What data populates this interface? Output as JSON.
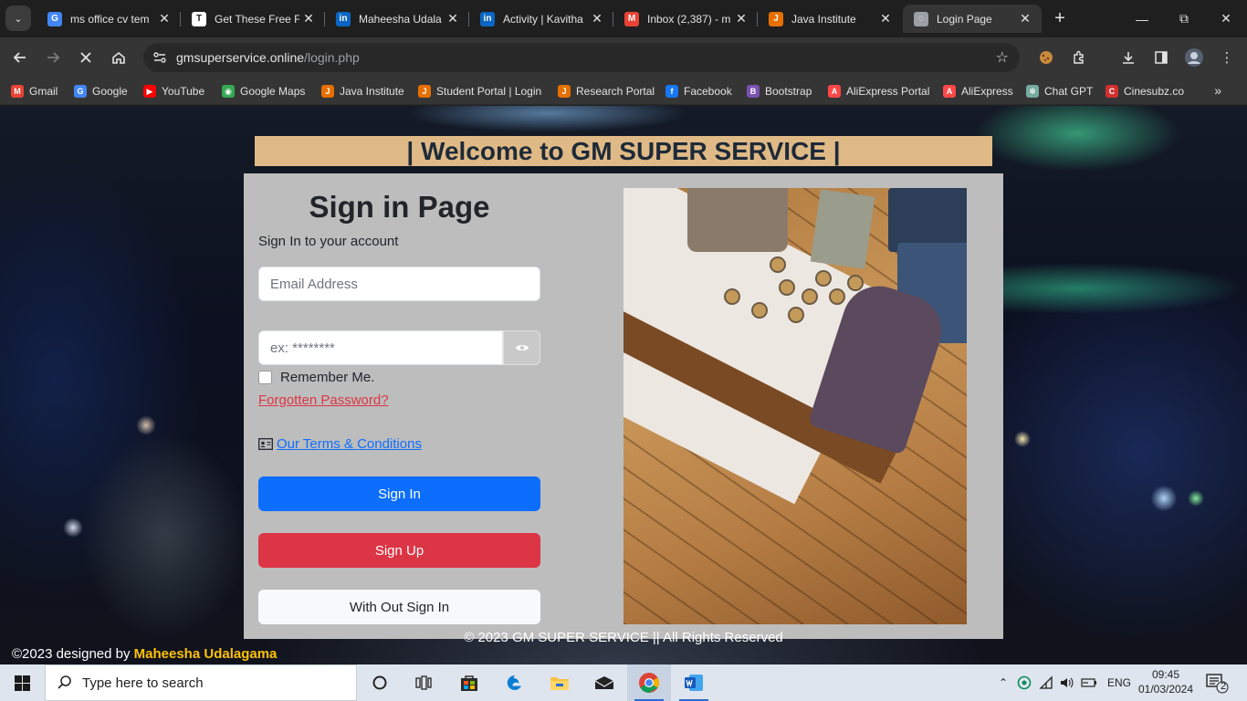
{
  "browser": {
    "tabs": [
      {
        "title": "ms office cv tem",
        "favicon": "google-icon",
        "color": "#4285f4",
        "glyph": "G"
      },
      {
        "title": "Get These Free F",
        "favicon": "doc-icon",
        "color": "#ffffff",
        "glyph": "T"
      },
      {
        "title": "Maheesha Udala",
        "favicon": "linkedin-icon",
        "color": "#0a66c2",
        "glyph": "in"
      },
      {
        "title": "Activity | Kavitha",
        "favicon": "linkedin-icon",
        "color": "#0a66c2",
        "glyph": "in"
      },
      {
        "title": "Inbox (2,387) - m",
        "favicon": "gmail-icon",
        "color": "#ea4335",
        "glyph": "M"
      },
      {
        "title": "Java Institute",
        "favicon": "java-icon",
        "color": "#e76f00",
        "glyph": "J"
      },
      {
        "title": "Login Page",
        "favicon": "loading-icon",
        "color": "#9aa0a6",
        "glyph": "◌",
        "active": true
      }
    ],
    "url_host": "gmsuperservice.online",
    "url_path": "/login.php"
  },
  "bookmarks": [
    {
      "label": "Gmail",
      "icon": "gmail-icon",
      "color": "#ea4335",
      "glyph": "M"
    },
    {
      "label": "Google",
      "icon": "google-icon",
      "color": "#4285f4",
      "glyph": "G"
    },
    {
      "label": "YouTube",
      "icon": "youtube-icon",
      "color": "#ff0000",
      "glyph": "▶"
    },
    {
      "label": "Google Maps",
      "icon": "maps-icon",
      "color": "#34a853",
      "glyph": "◉"
    },
    {
      "label": "Java Institute",
      "icon": "java-icon",
      "color": "#e76f00",
      "glyph": "J"
    },
    {
      "label": "Student Portal | Login",
      "icon": "java-icon",
      "color": "#e76f00",
      "glyph": "J"
    },
    {
      "label": "Research Portal",
      "icon": "java-icon",
      "color": "#e76f00",
      "glyph": "J"
    },
    {
      "label": "Facebook",
      "icon": "facebook-icon",
      "color": "#1877f2",
      "glyph": "f"
    },
    {
      "label": "Bootstrap",
      "icon": "bootstrap-icon",
      "color": "#7952b3",
      "glyph": "B"
    },
    {
      "label": "AliExpress Portal",
      "icon": "aliexpress-icon",
      "color": "#ff4747",
      "glyph": "A"
    },
    {
      "label": "AliExpress",
      "icon": "aliexpress-icon",
      "color": "#ff4747",
      "glyph": "A"
    },
    {
      "label": "Chat GPT",
      "icon": "chatgpt-icon",
      "color": "#74aa9c",
      "glyph": "✻"
    },
    {
      "label": "Cinesubz.co",
      "icon": "cinesubz-icon",
      "color": "#d32f2f",
      "glyph": "C"
    }
  ],
  "page": {
    "welcome": "| Welcome to GM SUPER SERVICE |",
    "title": "Sign in Page",
    "subtitle": "Sign In to your account",
    "email_placeholder": "Email Address",
    "password_placeholder": "ex: ********",
    "remember_label": "Remember Me.",
    "forgot_label": "Forgotten Password?",
    "terms_label": "Our Terms & Conditions",
    "signin_label": "Sign In",
    "signup_label": "Sign Up",
    "guest_label": "With Out Sign In",
    "footer_center": "© 2023 GM SUPER SERVICE || All Rights Reserved",
    "footer_left_prefix": "©2023 designed by ",
    "footer_author": "Maheesha Udalagama"
  },
  "colors": {
    "welcome_bg": "#e0ba86",
    "card_bg": "#bdbdbd",
    "signin": "#0d6efd",
    "signup": "#dc3545",
    "author": "#ffc107"
  },
  "taskbar": {
    "search_placeholder": "Type here to search",
    "language": "ENG",
    "time": "09:45",
    "date": "01/03/2024",
    "notification_count": "2"
  }
}
